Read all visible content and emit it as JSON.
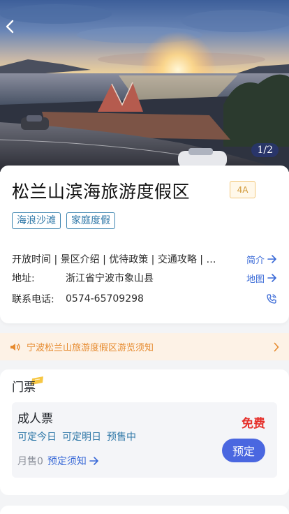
{
  "hero": {
    "image_name": "coastal resort photo",
    "page_counter": "1/2"
  },
  "info": {
    "title": "松兰山滨海旅游度假区",
    "level": "4A",
    "tags": [
      "海浪沙滩",
      "家庭度假"
    ],
    "intro_value": "开放时间 | 景区介绍 | 优待政策 | 交通攻略 | …",
    "intro_link": "简介",
    "address_label": "地址:",
    "address_value": "浙江省宁波市象山县",
    "address_link": "地图",
    "phone_label": "联系电话:",
    "phone_value": "0574-65709298"
  },
  "notice": {
    "text": "宁波松兰山旅游度假区游览须知"
  },
  "tickets": {
    "section_title": "门票",
    "item": {
      "name": "成人票",
      "price": "免费",
      "options": [
        "可定今日",
        "可定明日",
        "预售中"
      ],
      "monthly_sales": "月售0",
      "rules_link": "预定须知",
      "book_label": "预定"
    }
  },
  "colors": {
    "accent": "#4a67e0",
    "link": "#3a6ad7",
    "tag": "#2f78a8",
    "price": "#e6302b",
    "notice": "#e68a2e"
  }
}
